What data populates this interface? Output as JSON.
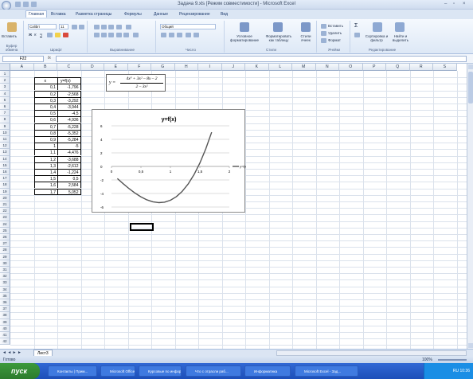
{
  "window": {
    "title": "Задача 9.xls  [Режим совместимости] - Microsoft Excel",
    "controls": [
      "–",
      "▫",
      "×"
    ]
  },
  "tabs": [
    {
      "label": "Главная",
      "active": true
    },
    {
      "label": "Вставка"
    },
    {
      "label": "Разметка страницы"
    },
    {
      "label": "Формулы"
    },
    {
      "label": "Данные"
    },
    {
      "label": "Рецензирование"
    },
    {
      "label": "Вид"
    }
  ],
  "ribbon": {
    "paste": "Вставить",
    "font_name": "Calibri",
    "font_size": "11",
    "number_format": "Общий",
    "cond_format": "Условное форматирование",
    "format_table": "Форматировать как таблицу",
    "cell_styles": "Стили ячеек",
    "insert": "Вставить",
    "delete": "Удалить",
    "format": "Формат",
    "sort": "Сортировка и фильтр",
    "find": "Найти и выделить",
    "groups": [
      "Буфер обмена",
      "Шрифт",
      "Выравнивание",
      "Число",
      "Стили",
      "Ячейки",
      "Редактирование"
    ]
  },
  "formula_bar": {
    "name_box": "F22",
    "fx": "fx",
    "content": ""
  },
  "columns": [
    "A",
    "B",
    "C",
    "D",
    "E",
    "F",
    "G",
    "H",
    "I",
    "J",
    "K",
    "L",
    "M",
    "N",
    "O",
    "P",
    "Q",
    "R",
    "S"
  ],
  "rows": [
    "1",
    "2",
    "3",
    "4",
    "5",
    "6",
    "7",
    "8",
    "9",
    "10",
    "11",
    "12",
    "13",
    "14",
    "15",
    "16",
    "17",
    "18",
    "19",
    "20",
    "21",
    "22",
    "23",
    "24",
    "25",
    "26",
    "27",
    "28",
    "29",
    "30",
    "31",
    "32",
    "33",
    "34",
    "35",
    "36",
    "37",
    "38",
    "39",
    "40",
    "41",
    "42"
  ],
  "table": {
    "header": [
      "x",
      "y=f(x)"
    ],
    "rows": [
      [
        "0,1",
        "-1,796"
      ],
      [
        "0,2",
        "-2,568"
      ],
      [
        "0,3",
        "-3,292"
      ],
      [
        "0,4",
        "-3,944"
      ],
      [
        "0,5",
        "-4,5"
      ],
      [
        "0,6",
        "-4,936"
      ],
      [
        "0,7",
        "-5,228"
      ],
      [
        "0,8",
        "-5,352"
      ],
      [
        "0,9",
        "-5,284"
      ],
      [
        "1",
        "-5"
      ],
      [
        "1,1",
        "-4,476"
      ],
      [
        "1,2",
        "-3,688"
      ],
      [
        "1,3",
        "-2,612"
      ],
      [
        "1,4",
        "-1,224"
      ],
      [
        "1,5",
        "0,5"
      ],
      [
        "1,6",
        "2,584"
      ],
      [
        "1,7",
        "5,052"
      ]
    ]
  },
  "formula_image": {
    "lhs": "y =",
    "numerator": "4x³ + 3x² – 8x – 2",
    "denominator": "2 – 3x²"
  },
  "chart_data": {
    "type": "line",
    "title": "y=f(x)",
    "x": [
      0.1,
      0.2,
      0.3,
      0.4,
      0.5,
      0.6,
      0.7,
      0.8,
      0.9,
      1.0,
      1.1,
      1.2,
      1.3,
      1.4,
      1.5,
      1.6,
      1.7
    ],
    "series": [
      {
        "name": "y=f(x)",
        "values": [
          -1.796,
          -2.568,
          -3.292,
          -3.944,
          -4.5,
          -4.936,
          -5.228,
          -5.352,
          -5.284,
          -5,
          -4.476,
          -3.688,
          -2.612,
          -1.224,
          0.5,
          2.584,
          5.052
        ]
      }
    ],
    "xticks": [
      "0",
      "0,5",
      "1",
      "1,5",
      "2"
    ],
    "yticks": [
      "6",
      "4",
      "2",
      "0",
      "-2",
      "-4",
      "-6"
    ],
    "xlim": [
      0,
      2
    ],
    "ylim": [
      -6,
      6
    ],
    "legend": "right",
    "color": "#555555"
  },
  "sheet_tabs": {
    "nav": "◄ ◄ ► ►",
    "sheet": "Лист3"
  },
  "status": {
    "left": "Готово",
    "zoom": "100%"
  },
  "taskbar": {
    "start": "пуск",
    "buttons": [
      "Контакты | Прим...",
      "Microsoft Office Picture...",
      "Курсовые по инфор...",
      "Что с отрасли раб...",
      "Информатика",
      "Microsoft Excel - Зад..."
    ],
    "tray": "RU 10:36"
  }
}
